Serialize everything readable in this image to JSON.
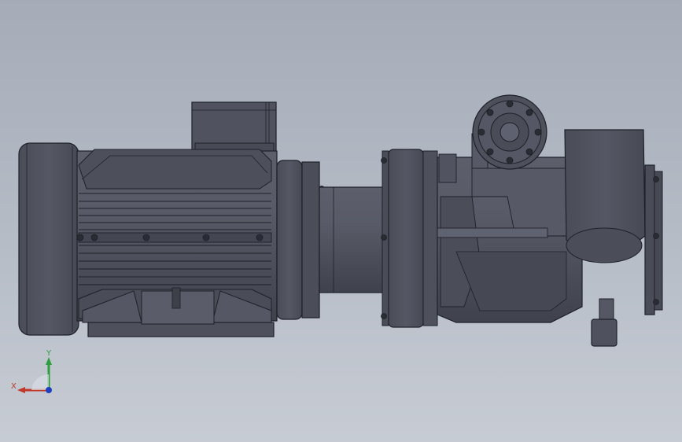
{
  "viewport": {
    "background_top": "#a5acb8",
    "background_bottom": "#c7ccd4",
    "model_color": "#4f525e",
    "edge_color": "#1e2028"
  },
  "triad": {
    "x_label": "X",
    "y_label": "Y",
    "x_color": "#c0392b",
    "y_color": "#2e9e3e",
    "z_color": "#1f3fbf"
  },
  "model": {
    "parts": [
      "motor-fan-cover",
      "motor-body",
      "terminal-box",
      "motor-flange",
      "coupling",
      "pump-flange",
      "pump-casing",
      "outlet-flange",
      "inlet-pipe",
      "drain-plug",
      "motor-feet"
    ]
  }
}
